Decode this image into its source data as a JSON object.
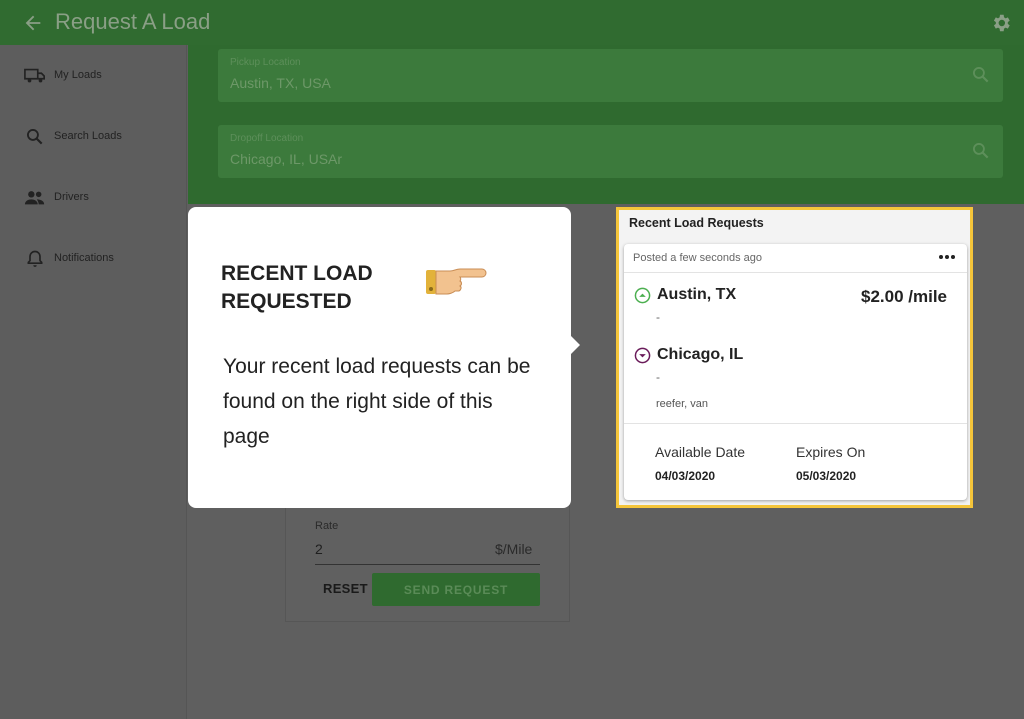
{
  "header": {
    "title": "Request A Load",
    "back_icon": "arrow-left-icon",
    "settings_icon": "gear-icon"
  },
  "sidebar": {
    "items": [
      {
        "label": "My Loads",
        "icon": "truck-icon"
      },
      {
        "label": "Search Loads",
        "icon": "search-icon"
      },
      {
        "label": "Drivers",
        "icon": "people-icon"
      },
      {
        "label": "Notifications",
        "icon": "bell-icon"
      }
    ]
  },
  "search": {
    "pickup": {
      "label": "Pickup Location",
      "value": "Austin, TX, USA"
    },
    "dropoff": {
      "label": "Dropoff Location",
      "value": "Chicago, IL, USAr"
    }
  },
  "form": {
    "rate_label": "Rate",
    "rate_value": "2",
    "rate_unit": "$/Mile",
    "reset_label": "RESET",
    "send_label": "SEND REQUEST"
  },
  "popover": {
    "title": "RECENT LOAD REQUESTED",
    "body": "Your recent load requests can be found on the right side of this page",
    "icon": "pointing-hand-icon"
  },
  "recent": {
    "title": "Recent Load Requests",
    "card": {
      "posted": "Posted a few seconds ago",
      "origin": "Austin, TX",
      "origin_sub": "-",
      "destination": "Chicago, IL",
      "destination_sub": "-",
      "rate": "$2.00 /mile",
      "equipment": "reefer, van",
      "available_label": "Available Date",
      "available_value": "04/03/2020",
      "expires_label": "Expires On",
      "expires_value": "05/03/2020"
    }
  },
  "colors": {
    "appbar": "#306b30",
    "highlight": "#f5c53a",
    "origin_pin": "#4caf50",
    "destination_pin": "#6a1b5a"
  }
}
